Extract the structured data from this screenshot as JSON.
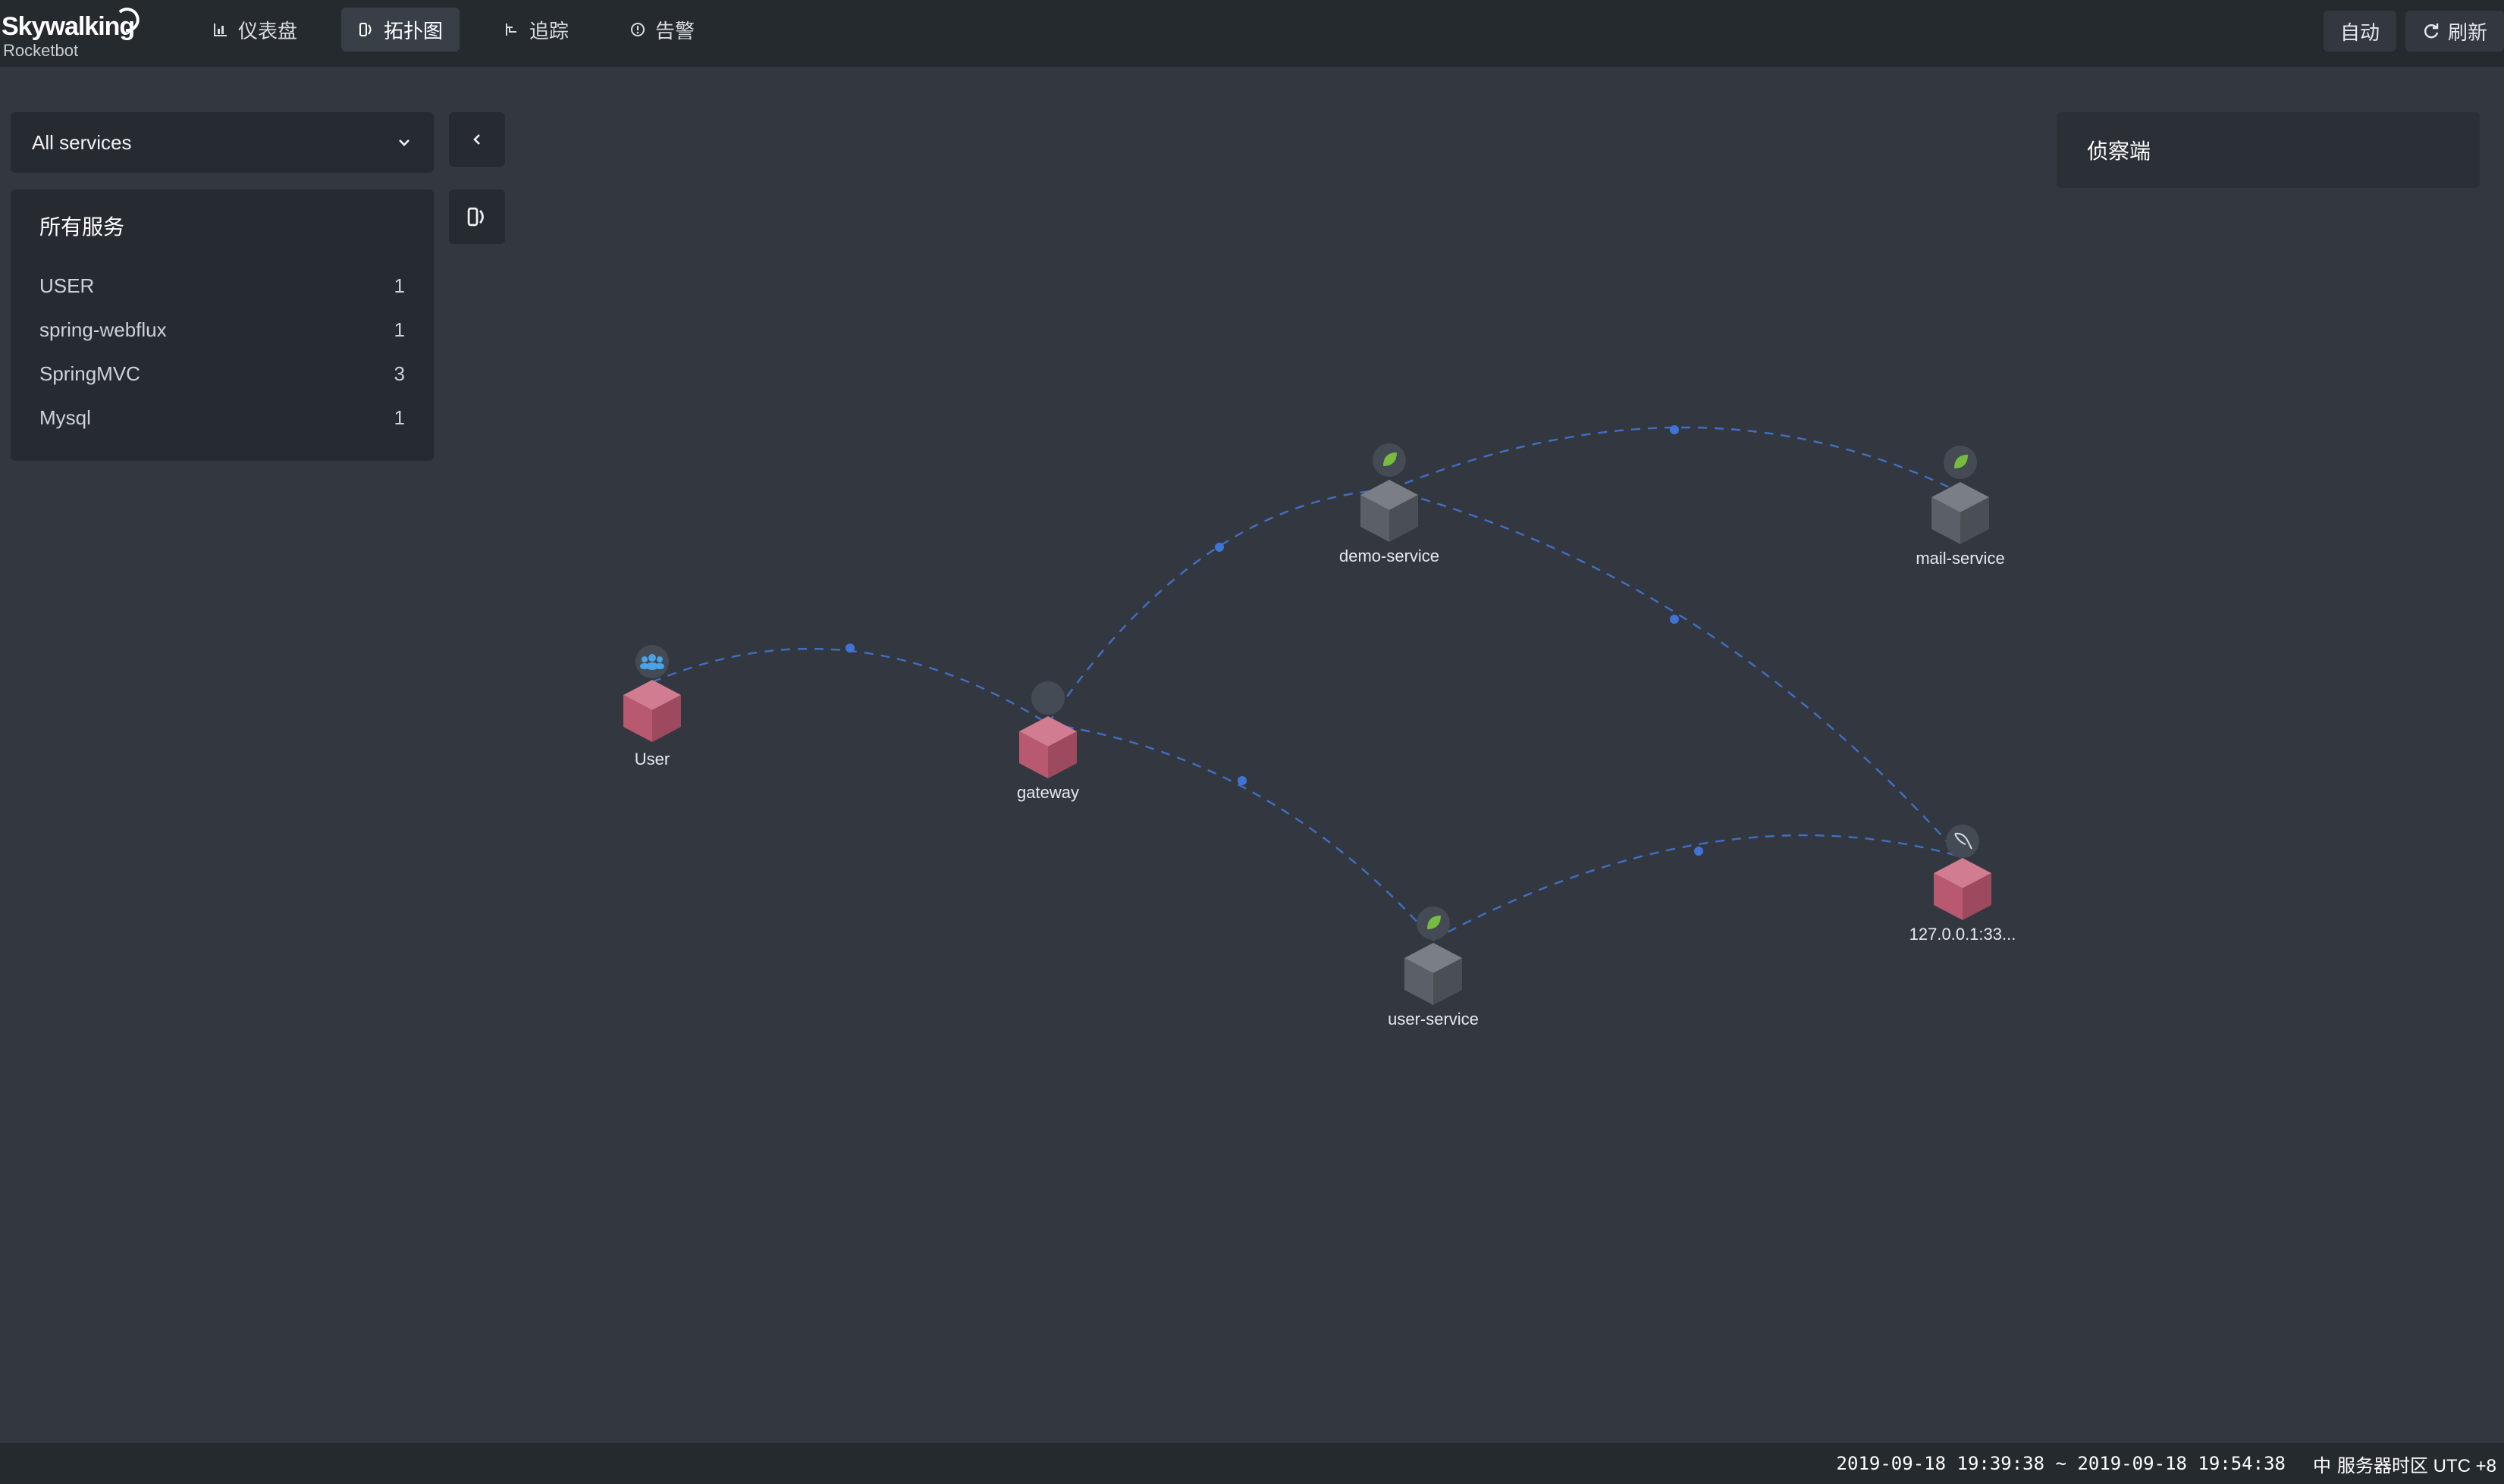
{
  "brand": {
    "title": "Skywalking",
    "subtitle": "Rocketbot"
  },
  "nav": [
    {
      "label": "仪表盘",
      "icon": "chart-icon"
    },
    {
      "label": "拓扑图",
      "icon": "topology-icon",
      "active": true
    },
    {
      "label": "追踪",
      "icon": "trace-icon"
    },
    {
      "label": "告警",
      "icon": "alarm-icon"
    }
  ],
  "header_right": {
    "auto_label": "自动",
    "refresh_label": "刷新"
  },
  "service_select": {
    "value": "All services"
  },
  "services_panel": {
    "title": "所有服务",
    "items": [
      {
        "name": "USER",
        "count": "1"
      },
      {
        "name": "spring-webflux",
        "count": "1"
      },
      {
        "name": "SpringMVC",
        "count": "3"
      },
      {
        "name": "Mysql",
        "count": "1"
      }
    ]
  },
  "probe_panel": {
    "title": "侦察端"
  },
  "topology": {
    "nodes": [
      {
        "id": "user",
        "label": "User",
        "type": "user",
        "color": "#b9596f",
        "icon": "users-icon"
      },
      {
        "id": "gateway",
        "label": "gateway",
        "type": "gateway",
        "color": "#b9596f",
        "icon": "blank-icon"
      },
      {
        "id": "demo",
        "label": "demo-service",
        "type": "spring",
        "color": "#5b5f67",
        "icon": "spring-leaf-icon"
      },
      {
        "id": "mail",
        "label": "mail-service",
        "type": "spring",
        "color": "#5b5f67",
        "icon": "spring-leaf-icon"
      },
      {
        "id": "usersvc",
        "label": "user-service",
        "type": "spring",
        "color": "#5b5f67",
        "icon": "spring-leaf-icon"
      },
      {
        "id": "mysql",
        "label": "127.0.0.1:33...",
        "type": "mysql",
        "color": "#b9596f",
        "icon": "mysql-dolphin-icon"
      }
    ],
    "edge_color": "#3f6fc4"
  },
  "footer": {
    "time_range": "2019-09-18 19:39:38 ~ 2019-09-18 19:54:38",
    "lang": "中",
    "timezone": "服务器时区 UTC +8"
  }
}
